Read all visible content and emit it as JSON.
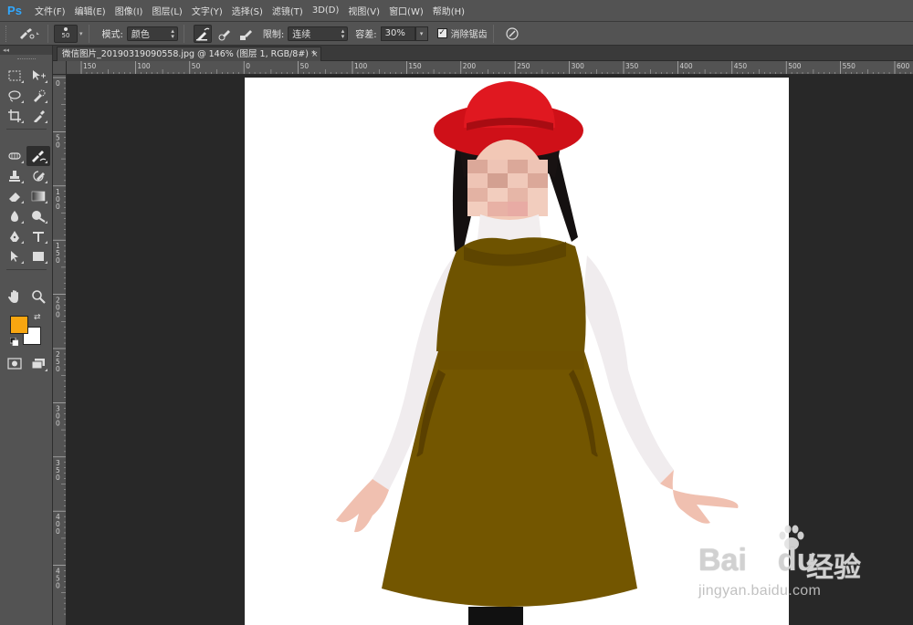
{
  "app": {
    "logo": "Ps"
  },
  "menu": [
    {
      "label": "文件(F)"
    },
    {
      "label": "编辑(E)"
    },
    {
      "label": "图像(I)"
    },
    {
      "label": "图层(L)"
    },
    {
      "label": "文字(Y)"
    },
    {
      "label": "选择(S)"
    },
    {
      "label": "滤镜(T)"
    },
    {
      "label": "3D(D)"
    },
    {
      "label": "视图(V)"
    },
    {
      "label": "窗口(W)"
    },
    {
      "label": "帮助(H)"
    }
  ],
  "options_bar": {
    "brush_size": "50",
    "mode_label": "模式:",
    "mode_value": "颜色",
    "limits_label": "限制:",
    "limits_value": "连续",
    "tolerance_label": "容差:",
    "tolerance_value": "30%",
    "antialias_label": "消除锯齿",
    "antialias_checked": true
  },
  "document": {
    "tab_title": "微信图片_20190319090558.jpg @ 146% (图层 1, RGB/8#) *",
    "close_glyph": "×"
  },
  "rulers": {
    "horizontal_labels": [
      "150",
      "100",
      "50",
      "0",
      "50",
      "100",
      "150",
      "200",
      "250",
      "300",
      "350",
      "400",
      "450",
      "500",
      "550",
      "600"
    ],
    "vertical_labels": [
      "0",
      "5 0",
      "1 0 0",
      "1 5 0",
      "2 0 0",
      "2 5 0",
      "3 0 0",
      "3 5 0",
      "4 0 0",
      "4 5 0"
    ]
  },
  "colors": {
    "foreground": "#f8a610",
    "background": "#ffffff"
  },
  "tools": [
    "rectangular-marquee",
    "move",
    "lasso",
    "quick-selection",
    "crop",
    "eyedropper",
    "spot-healing-brush",
    "color-replacement-brush",
    "clone-stamp",
    "history-brush",
    "eraser",
    "gradient",
    "blur",
    "dodge",
    "pen",
    "type",
    "path-selection",
    "rectangle",
    "hand",
    "zoom"
  ],
  "watermark": {
    "brand": "Bai",
    "brand2": "du",
    "cn": "经验",
    "url": "jingyan.baidu.com"
  }
}
